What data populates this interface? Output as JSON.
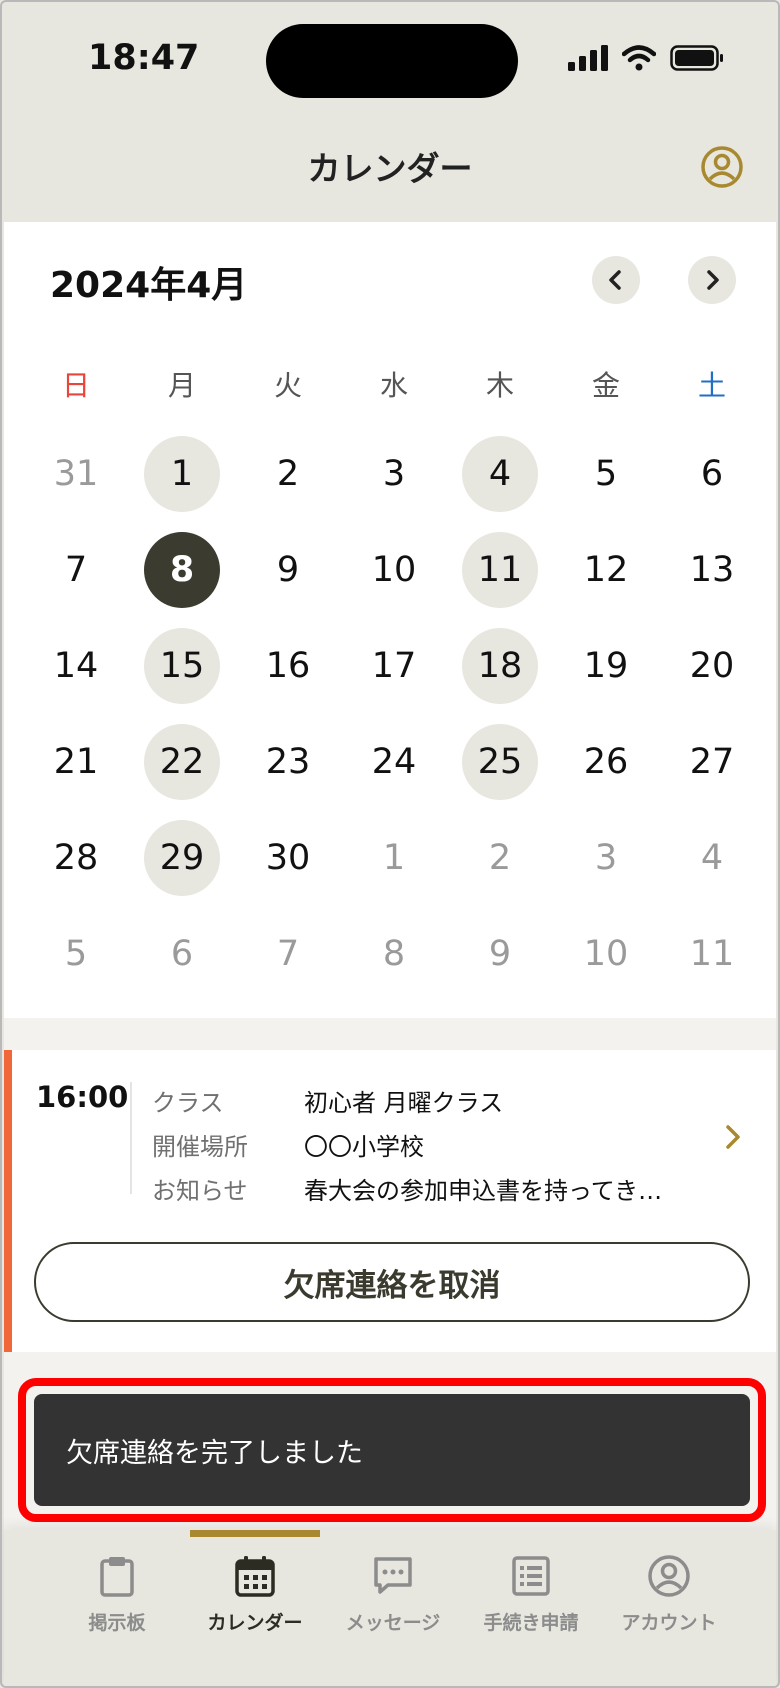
{
  "status_bar": {
    "time": "18:47"
  },
  "header": {
    "title": "カレンダー"
  },
  "calendar": {
    "month": "2024年4月",
    "weekdays": [
      "日",
      "月",
      "火",
      "水",
      "木",
      "金",
      "土"
    ],
    "weeks": [
      [
        {
          "d": "31",
          "m": true
        },
        {
          "d": "1",
          "e": true
        },
        {
          "d": "2"
        },
        {
          "d": "3"
        },
        {
          "d": "4",
          "e": true
        },
        {
          "d": "5"
        },
        {
          "d": "6"
        }
      ],
      [
        {
          "d": "7"
        },
        {
          "d": "8",
          "s": true
        },
        {
          "d": "9"
        },
        {
          "d": "10"
        },
        {
          "d": "11",
          "e": true
        },
        {
          "d": "12"
        },
        {
          "d": "13"
        }
      ],
      [
        {
          "d": "14"
        },
        {
          "d": "15",
          "e": true
        },
        {
          "d": "16"
        },
        {
          "d": "17"
        },
        {
          "d": "18",
          "e": true
        },
        {
          "d": "19"
        },
        {
          "d": "20"
        }
      ],
      [
        {
          "d": "21"
        },
        {
          "d": "22",
          "e": true
        },
        {
          "d": "23"
        },
        {
          "d": "24"
        },
        {
          "d": "25",
          "e": true
        },
        {
          "d": "26"
        },
        {
          "d": "27"
        }
      ],
      [
        {
          "d": "28"
        },
        {
          "d": "29",
          "e": true
        },
        {
          "d": "30"
        },
        {
          "d": "1",
          "m": true
        },
        {
          "d": "2",
          "m": true
        },
        {
          "d": "3",
          "m": true
        },
        {
          "d": "4",
          "m": true
        }
      ],
      [
        {
          "d": "5",
          "m": true
        },
        {
          "d": "6",
          "m": true
        },
        {
          "d": "7",
          "m": true
        },
        {
          "d": "8",
          "m": true
        },
        {
          "d": "9",
          "m": true
        },
        {
          "d": "10",
          "m": true
        },
        {
          "d": "11",
          "m": true
        }
      ]
    ]
  },
  "event": {
    "time": "16:00",
    "rows": [
      {
        "label": "クラス",
        "value": "初心者 月曜クラス"
      },
      {
        "label": "開催場所",
        "value": "〇〇小学校"
      },
      {
        "label": "お知らせ",
        "value": "春大会の参加申込書を持ってき…"
      }
    ],
    "cancel_label": "欠席連絡を取消"
  },
  "toast": {
    "message": "欠席連絡を完了しました"
  },
  "tabbar": {
    "items": [
      {
        "label": "掲示板",
        "icon": "clipboard-icon"
      },
      {
        "label": "カレンダー",
        "icon": "calendar-icon",
        "active": true
      },
      {
        "label": "メッセージ",
        "icon": "message-icon"
      },
      {
        "label": "手続き申請",
        "icon": "form-icon"
      },
      {
        "label": "アカウント",
        "icon": "account-icon"
      }
    ]
  },
  "colors": {
    "accent": "#a8892f",
    "selected_day": "#3c3b2f",
    "event_bar": "#f0673a",
    "sunday": "#e8453c",
    "saturday": "#1f6fc4",
    "toast_bg": "#333333",
    "highlight": "#ff0000"
  }
}
